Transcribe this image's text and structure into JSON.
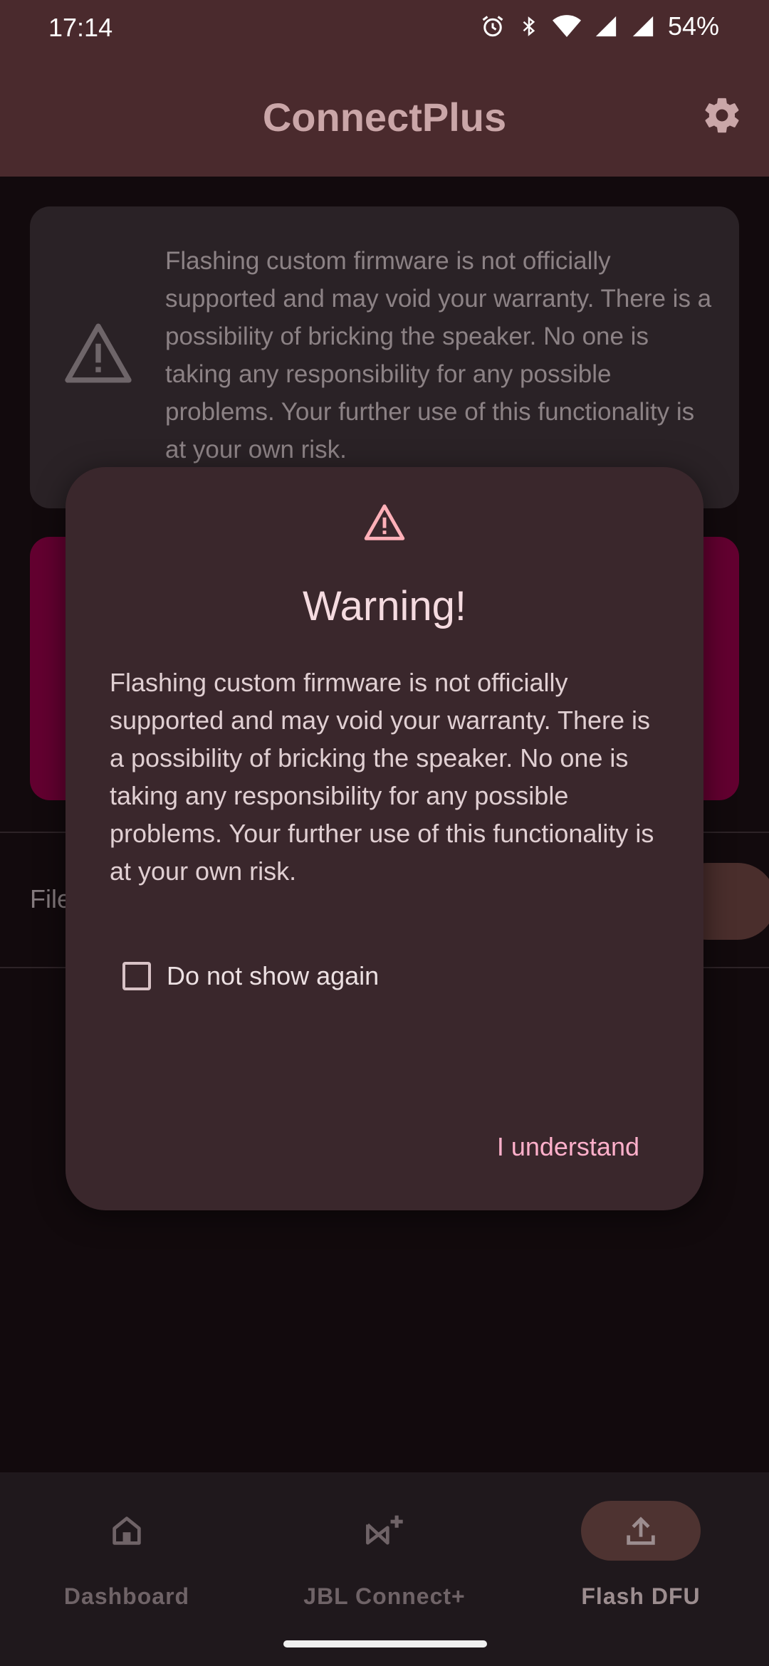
{
  "status_bar": {
    "time": "17:14",
    "battery": "54%",
    "icons": [
      "alarm-icon",
      "bluetooth-icon",
      "wifi-icon",
      "signal-icon",
      "signal-icon"
    ]
  },
  "app_bar": {
    "title": "ConnectPlus",
    "settings_icon": "gear-icon"
  },
  "info_card": {
    "text": "Flashing custom firmware is not officially supported and may void your warranty. There is a possibility of bricking the speaker. No one is taking any responsibility for any possible problems. Your further use of this functionality is at your own risk."
  },
  "file_row": {
    "label": "File"
  },
  "dialog": {
    "title": "Warning!",
    "body": "Flashing custom firmware is not officially supported and may void your warranty. There is a possibility of bricking the speaker. No one is taking any responsibility for any possible problems. Your further use of this functionality is at your own risk.",
    "checkbox_label": "Do not show again",
    "checkbox_checked": false,
    "confirm_label": "I understand"
  },
  "bottom_nav": {
    "items": [
      {
        "label": "Dashboard",
        "icon": "home-icon",
        "active": false
      },
      {
        "label": "JBL Connect+",
        "icon": "connect-icon",
        "active": false
      },
      {
        "label": "Flash DFU",
        "icon": "upload-icon",
        "active": true
      }
    ]
  },
  "colors": {
    "app_bar": "#4a2a2d",
    "dialog_bg": "#3a272c",
    "accent": "#ffb0cb",
    "flash_card": "#630030"
  }
}
